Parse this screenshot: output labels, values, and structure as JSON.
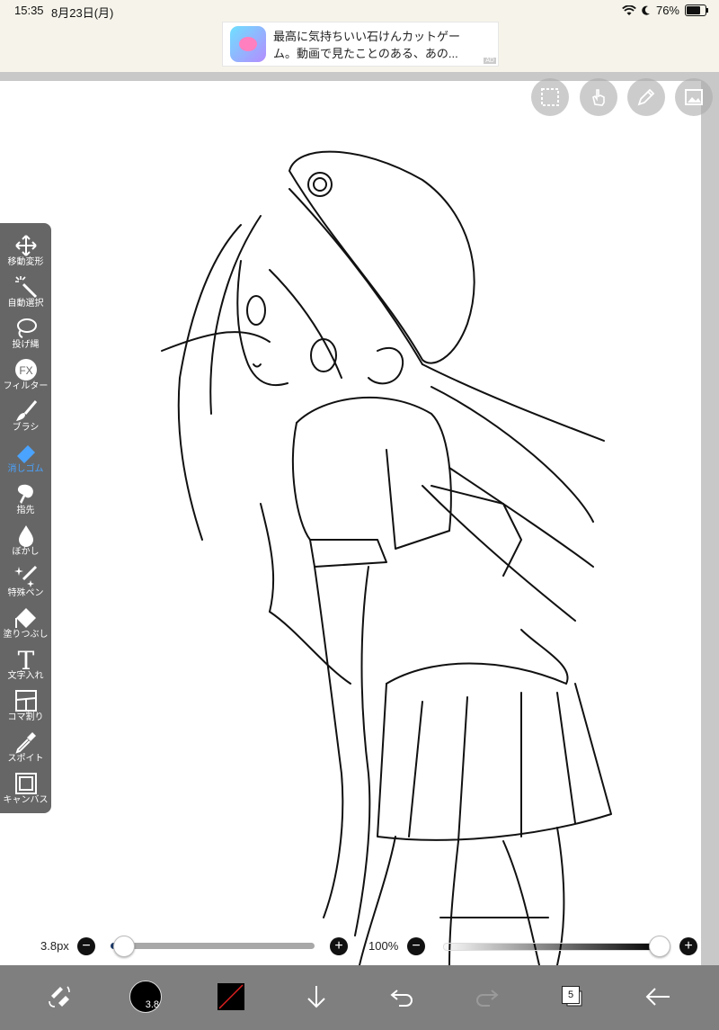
{
  "status_bar": {
    "time": "15:35",
    "date": "8月23日(月)",
    "battery": "76%",
    "battery_level": 0.76
  },
  "ad": {
    "line1": "最高に気持ちいい石けんカットゲー",
    "line2": "ム。動画で見たことのある、あの...",
    "tag": "AD"
  },
  "toolbar": {
    "items": [
      {
        "label": "移動変形",
        "icon": "move-icon"
      },
      {
        "label": "自動選択",
        "icon": "magic-wand-icon"
      },
      {
        "label": "投げ縄",
        "icon": "lasso-icon"
      },
      {
        "label": "フィルター",
        "icon": "fx-icon"
      },
      {
        "label": "ブラシ",
        "icon": "brush-icon"
      },
      {
        "label": "消しゴム",
        "icon": "eraser-icon",
        "active": true
      },
      {
        "label": "指先",
        "icon": "smudge-icon"
      },
      {
        "label": "ぼかし",
        "icon": "blur-drop-icon"
      },
      {
        "label": "特殊ペン",
        "icon": "special-pen-icon"
      },
      {
        "label": "塗りつぶし",
        "icon": "fill-icon"
      },
      {
        "label": "文字入れ",
        "icon": "text-icon"
      },
      {
        "label": "コマ割り",
        "icon": "frame-divider-icon"
      },
      {
        "label": "スポイト",
        "icon": "eyedropper-icon"
      },
      {
        "label": "キャンバス",
        "icon": "canvas-icon"
      }
    ],
    "fx_text": "FX",
    "text_glyph": "T",
    "active_color": "#4aa3ff"
  },
  "top_buttons": [
    "selection-icon",
    "hand-gesture-icon",
    "pen-settings-icon",
    "gallery-icon"
  ],
  "brush_size": {
    "label": "3.8px",
    "minus": "−",
    "plus": "+",
    "level": 0.02
  },
  "opacity": {
    "label": "100%",
    "minus": "−",
    "plus": "+",
    "level": 1.0
  },
  "bottom_bar": {
    "brush_size_badge": "3.8",
    "layer_count": "5",
    "accent": "#7f7f7f"
  }
}
